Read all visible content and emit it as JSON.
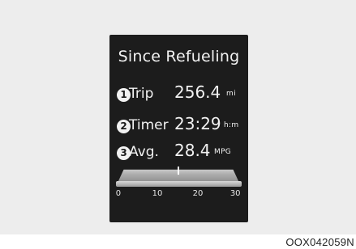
{
  "display": {
    "title": "Since Refueling",
    "rows": [
      {
        "number": "1",
        "label": "Trip",
        "value": "256.4",
        "unit": "mi"
      },
      {
        "number": "2",
        "label": "Timer",
        "value": "23:29",
        "unit": "h:m"
      },
      {
        "number": "3",
        "label": "Avg.",
        "value": "28.4",
        "unit": "MPG"
      }
    ],
    "gauge": {
      "ticks": [
        "0",
        "10",
        "20",
        "30"
      ],
      "min": 0,
      "max": 30,
      "value": 15
    }
  },
  "caption": "OOX042059N",
  "colors": {
    "screen_background": "#1c1c1c",
    "page_background": "#ededed",
    "text": "#f2f2f2"
  }
}
